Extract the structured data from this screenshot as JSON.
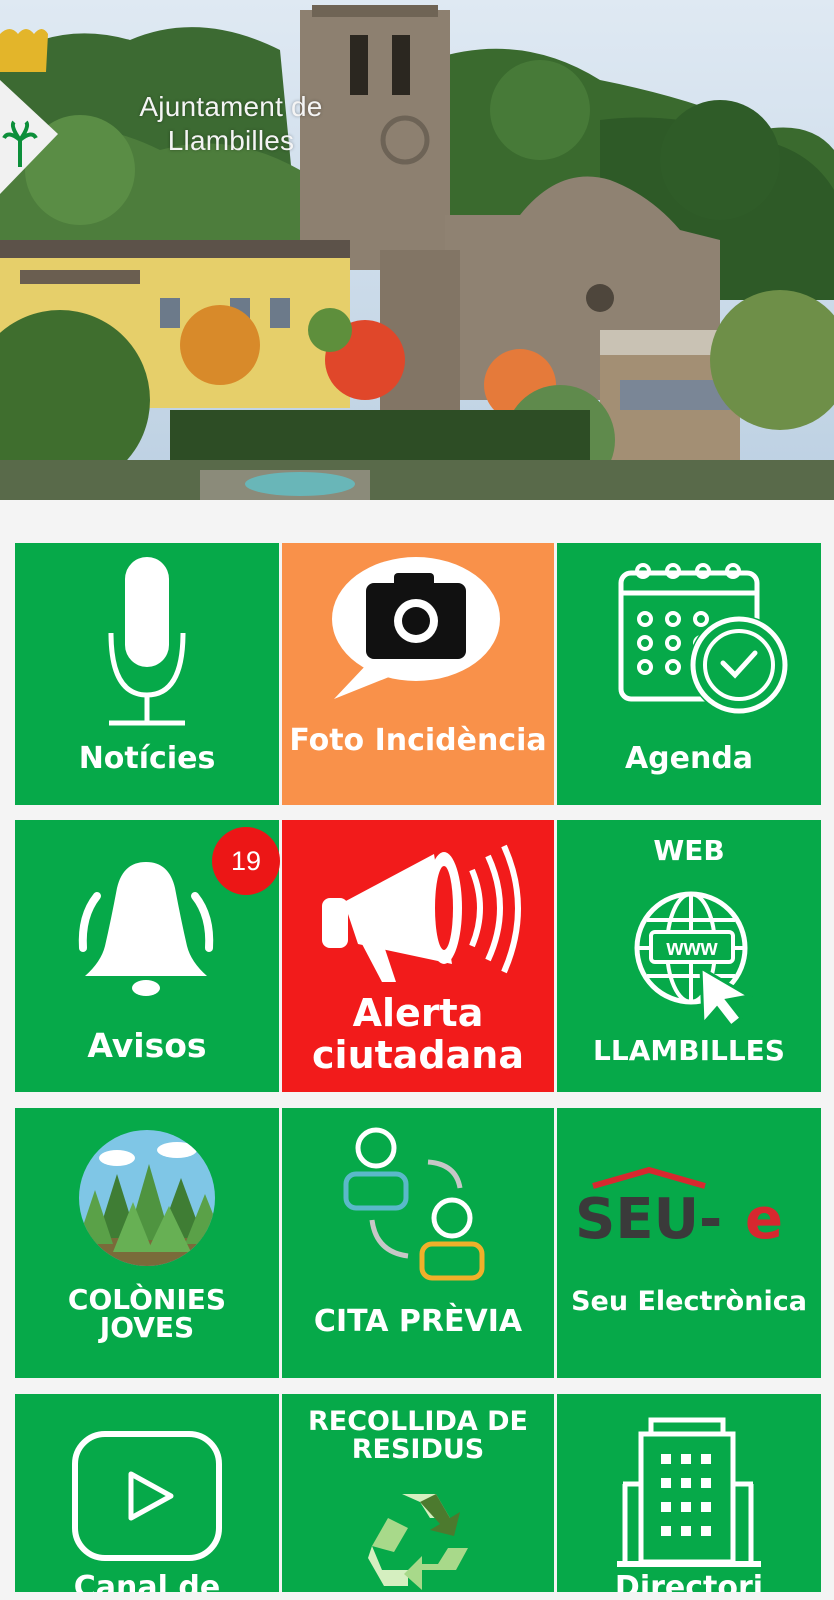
{
  "header": {
    "title_line1": "Ajuntament de",
    "title_line2": "Llambilles"
  },
  "tiles": {
    "noticies": "Notícies",
    "foto_incidencia": "Foto Incidència",
    "agenda": "Agenda",
    "avisos": "Avisos",
    "avisos_badge": "19",
    "alerta_line1": "Alerta",
    "alerta_line2": "ciutadana",
    "web_top": "WEB",
    "web_bottom": "LLAMBILLES",
    "www_text": "www",
    "colonies_line1": "COLÒNIES",
    "colonies_line2": "JOVES",
    "cita_previa": "CITA PRÈVIA",
    "seu_logo": "SEU-",
    "seu_logo_e": "e",
    "seu_electronica": "Seu Electrònica",
    "recollida_line1": "RECOLLIDA DE",
    "recollida_line2": "RESIDUS",
    "canal": "Canal de",
    "directori": "Directori"
  },
  "colors": {
    "green": "#06a949",
    "orange": "#f9914a",
    "red": "#f21b1b",
    "badge": "#ec1616",
    "seu_dark": "#3a3a3a",
    "seu_red": "#d7282f"
  },
  "icons": [
    "microphone-icon",
    "camera-speech-icon",
    "calendar-clock-icon",
    "bell-icon",
    "megaphone-icon",
    "www-globe-cursor-icon",
    "forest-icon",
    "people-exchange-icon",
    "seu-e-logo",
    "play-video-icon",
    "recycle-icon",
    "building-icon"
  ]
}
